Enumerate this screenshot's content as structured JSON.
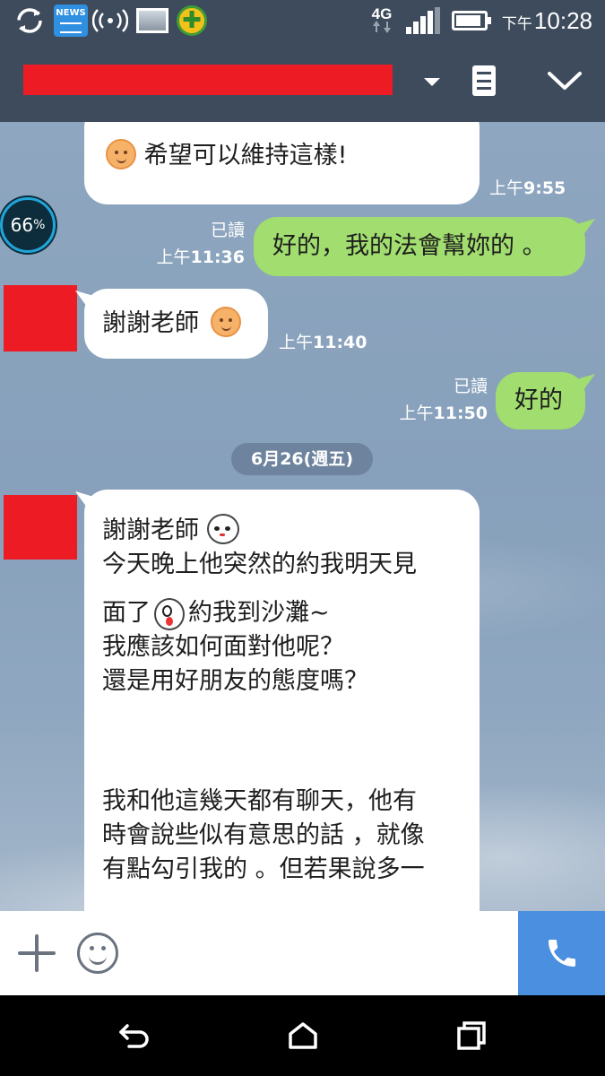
{
  "status_bar": {
    "network": "4G",
    "time_ampm": "下午",
    "time": "10:28",
    "news_label": "NEWS",
    "battery_level": 0.8,
    "icons": [
      "sync-icon",
      "news-icon",
      "nfc-signal-icon",
      "photo-icon",
      "plus-app-icon",
      "4g-icon",
      "signal-bars-icon",
      "battery-icon"
    ]
  },
  "header": {
    "title": "",
    "buttons": [
      "chevron-down-icon",
      "notes-icon",
      "collapse-chevron-icon"
    ]
  },
  "widget": {
    "battery_percent": "66",
    "percent_sign": "%"
  },
  "messages": [
    {
      "id": "m1",
      "side": "in",
      "text": "希望可以維持這樣!",
      "emoji": "smiley",
      "time_prefix": "上午",
      "time": "9:55"
    },
    {
      "id": "m2",
      "side": "out",
      "text": "好的，我的法會幫妳的 。",
      "read": "已讀",
      "time_prefix": "上午",
      "time": "11:36"
    },
    {
      "id": "m3",
      "side": "in",
      "text": "謝謝老師",
      "emoji": "smiley",
      "time_prefix": "上午",
      "time": "11:40"
    },
    {
      "id": "m4",
      "side": "out",
      "text": "好的",
      "read": "已讀",
      "time_prefix": "上午",
      "time": "11:50"
    },
    {
      "id": "m5",
      "side": "in",
      "lines": [
        "謝謝老師",
        "今天晚上他突然的約我明天見",
        "面了",
        "約我到沙灘~",
        "我應該如何面對他呢？",
        "還是用好朋友的態度嗎？",
        "我和他這幾天都有聊天，他有",
        "時會說些似有意思的話 ，就像",
        "有點勾引我的 。但若果說多一"
      ]
    }
  ],
  "date_divider": "6月26(週五)",
  "colors": {
    "header_bg": "#3d4b5c",
    "outgoing_bubble": "#a1dd6f",
    "incoming_bubble": "#ffffff",
    "call_button": "#4a8fe0",
    "redaction": "#ed1c24"
  },
  "input_bar": {
    "buttons": [
      "plus-icon",
      "emoji-icon",
      "phone-icon"
    ]
  },
  "nav_bar": {
    "buttons": [
      "back-icon",
      "home-icon",
      "recents-icon"
    ]
  }
}
